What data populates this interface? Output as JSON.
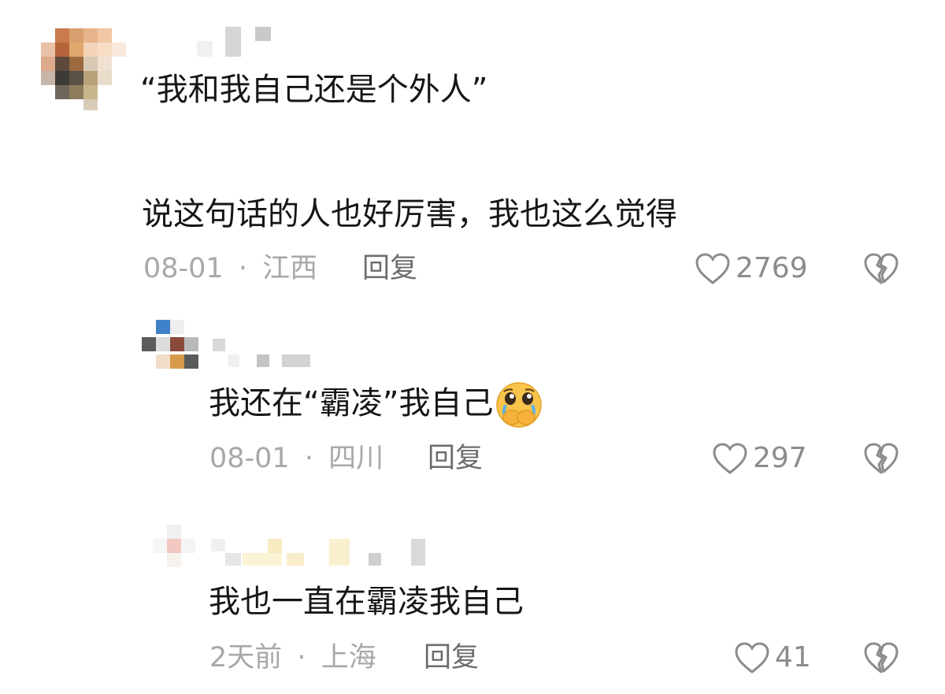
{
  "comments": [
    {
      "text_line1": "“我和我自己还是个外人”",
      "text_line2": "说这句话的人也好厉害，我也这么觉得",
      "date": "08-01",
      "location": "江西",
      "reply_label": "回复",
      "likes": "2769"
    },
    {
      "text": "我还在“霸凌”我自己",
      "emoji": "crying-face-emoji",
      "date": "08-01",
      "location": "四川",
      "reply_label": "回复",
      "likes": "297"
    },
    {
      "text": "我也一直在霸凌我自己",
      "date": "2天前",
      "location": "上海",
      "reply_label": "回复",
      "likes": "41"
    }
  ],
  "separator": "·",
  "colors": {
    "text": "#161616",
    "meta": "#a8a8a8",
    "reply": "#6d6d6d",
    "icon": "#8c8c8c"
  }
}
